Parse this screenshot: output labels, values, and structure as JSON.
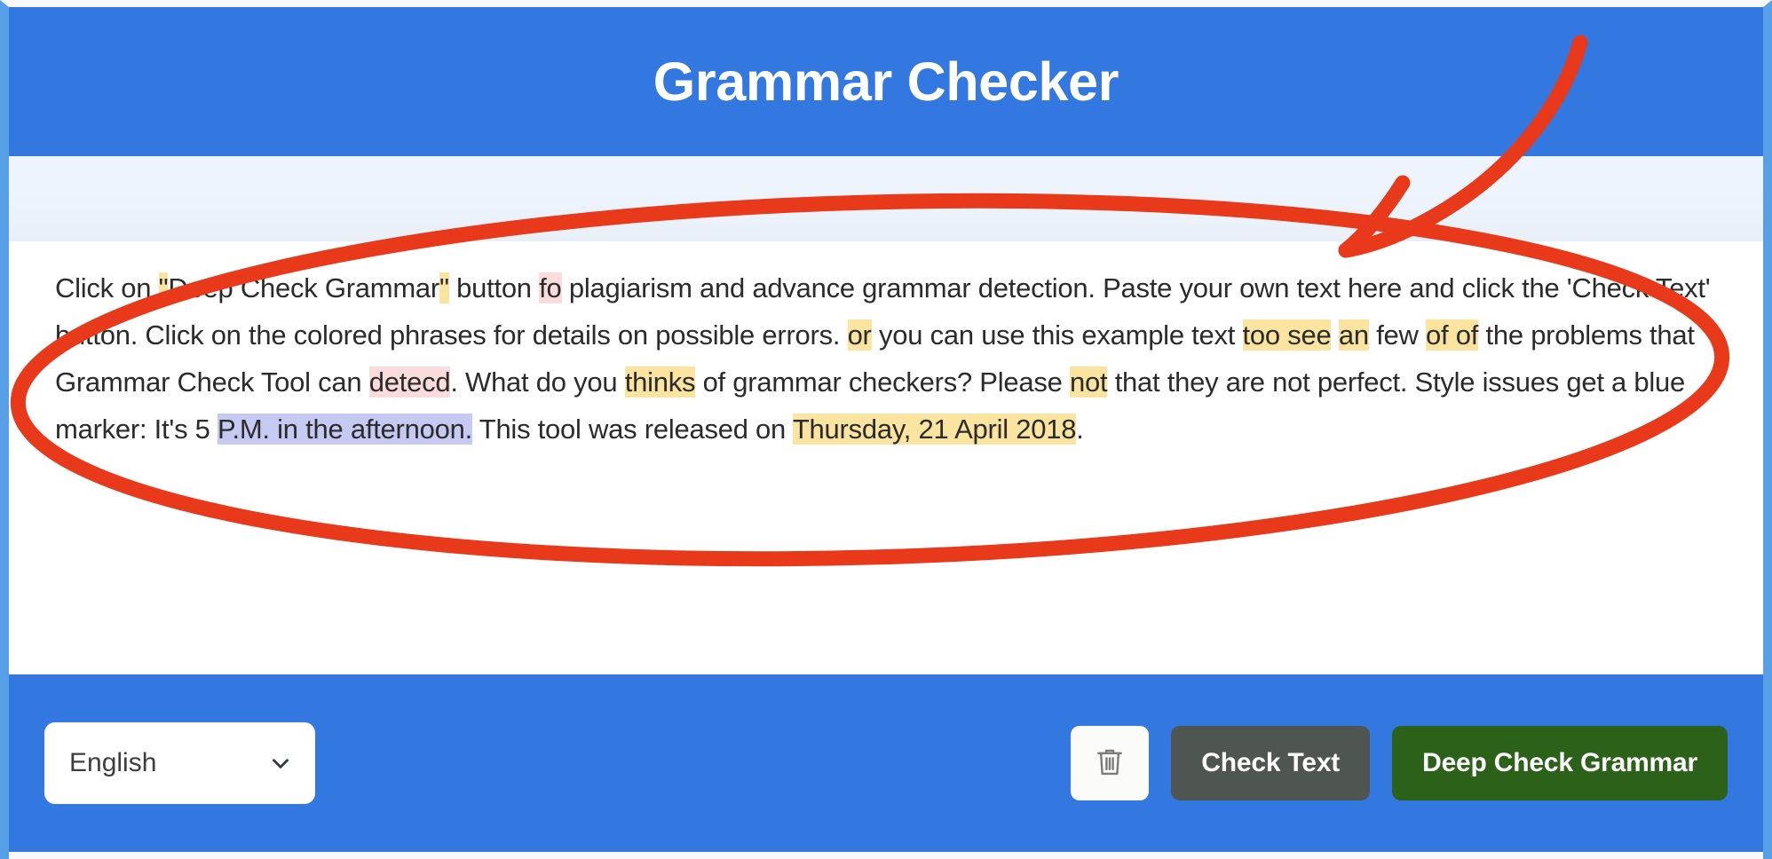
{
  "header": {
    "title": "Grammar Checker"
  },
  "editor": {
    "segments": [
      {
        "text": "Click on ",
        "highlight": "none"
      },
      {
        "text": "\"",
        "highlight": "yellow"
      },
      {
        "text": "Deep Check Grammar",
        "highlight": "none"
      },
      {
        "text": "\"",
        "highlight": "yellow"
      },
      {
        "text": " button ",
        "highlight": "none"
      },
      {
        "text": "fo",
        "highlight": "pink"
      },
      {
        "text": " plagiarism and advance grammar detection. Paste your own text here and click the 'Check Text' button. Click on the colored phrases for details on possible errors. ",
        "highlight": "none"
      },
      {
        "text": "or",
        "highlight": "yellow"
      },
      {
        "text": " you can use this example text ",
        "highlight": "none"
      },
      {
        "text": "too see",
        "highlight": "yellow"
      },
      {
        "text": " ",
        "highlight": "none"
      },
      {
        "text": "an",
        "highlight": "yellow"
      },
      {
        "text": " few ",
        "highlight": "none"
      },
      {
        "text": "of of",
        "highlight": "yellow"
      },
      {
        "text": " the problems that Grammar Check Tool can ",
        "highlight": "none"
      },
      {
        "text": "detecd",
        "highlight": "pink"
      },
      {
        "text": ". What do you ",
        "highlight": "none"
      },
      {
        "text": "thinks",
        "highlight": "yellow"
      },
      {
        "text": " of grammar checkers? Please ",
        "highlight": "none"
      },
      {
        "text": "not",
        "highlight": "yellow"
      },
      {
        "text": " that they are not perfect. Style issues get a blue marker: It's 5 ",
        "highlight": "none"
      },
      {
        "text": "P.M. in the afternoon.",
        "highlight": "blue"
      },
      {
        "text": " This tool was released on ",
        "highlight": "none"
      },
      {
        "text": "Thursday, 21 April 2018",
        "highlight": "yellow"
      },
      {
        "text": ".",
        "highlight": "none"
      }
    ]
  },
  "footer": {
    "language": {
      "selected": "English",
      "chevron_icon": "chevron-down-icon"
    },
    "clear_button": {
      "icon": "trash-icon"
    },
    "check_text_label": "Check Text",
    "deep_check_label": "Deep Check Grammar"
  },
  "colors": {
    "header_blue": "#3377e0",
    "footer_blue": "#3377e0",
    "strip_light": "#eff5fd",
    "check_gray": "#4f5551",
    "deep_green": "#2b6119",
    "highlight_yellow": "#fae4a0",
    "highlight_pink": "#fadcdc",
    "highlight_blue": "#c6c9f2",
    "annotation_red": "#e8391b",
    "page_edge_blue": "#57a0e8"
  },
  "annotation": {
    "shape": "ellipse-with-arrow",
    "color": "#e8391b"
  }
}
